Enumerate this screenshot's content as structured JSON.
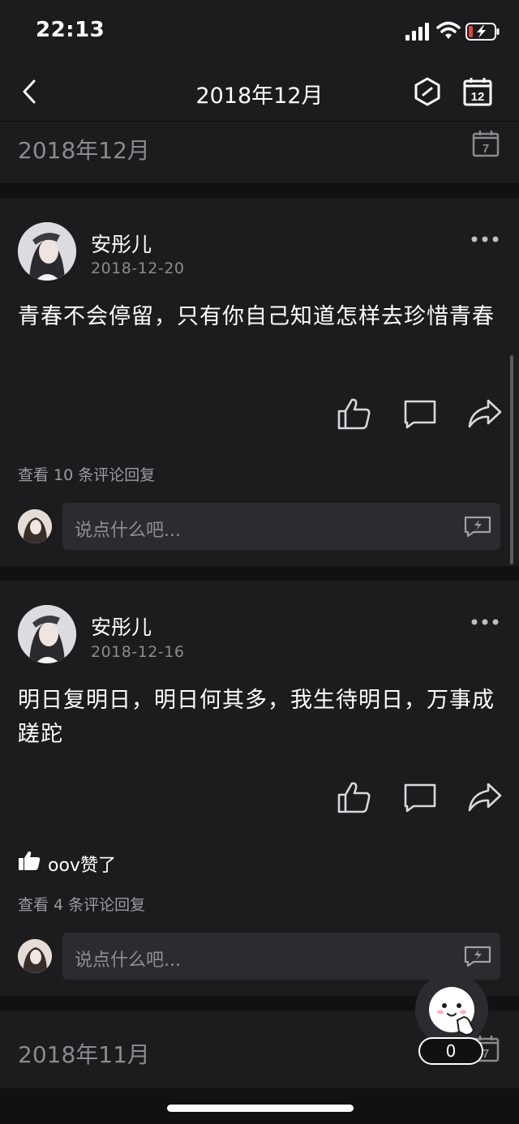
{
  "status_bar": {
    "time": "22:13"
  },
  "nav": {
    "title": "2018年12月"
  },
  "month_header_top": {
    "label": "2018年12月",
    "calendar_day": "7"
  },
  "nav_calendar_day": "12",
  "posts": [
    {
      "user": "安彤儿",
      "date": "2018-12-20",
      "text": "青春不会停留，只有你自己知道怎样去珍惜青春",
      "comments_link": "查看 10 条评论回复",
      "comment_placeholder": "说点什么吧..."
    },
    {
      "user": "安彤儿",
      "date": "2018-12-16",
      "text": "明日复明日，明日何其多，我生待明日，万事成蹉跎",
      "liked_by": "oov赞了",
      "comments_link": "查看 4 条评论回复",
      "comment_placeholder": "说点什么吧..."
    }
  ],
  "month_header_bottom": {
    "label": "2018年11月",
    "calendar_day": "7"
  },
  "floating": {
    "counter": "0"
  }
}
